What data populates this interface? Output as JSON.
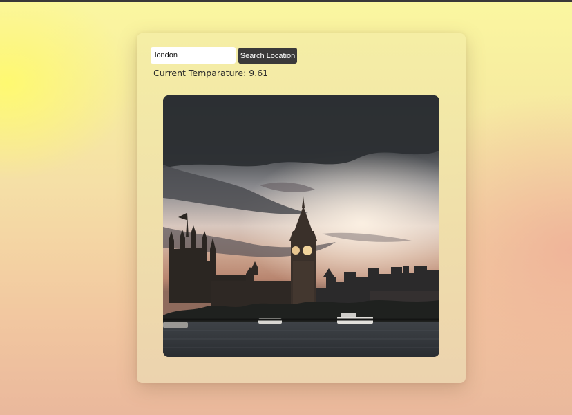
{
  "search": {
    "value": "london",
    "placeholder": "",
    "button_label": "Search Location"
  },
  "weather": {
    "label": "Current Temparature:",
    "value": "9.61"
  },
  "image": {
    "subject": "london-skyline-photo"
  },
  "colors": {
    "button_bg": "#3b3a3a",
    "top_bar": "#3a3838"
  }
}
